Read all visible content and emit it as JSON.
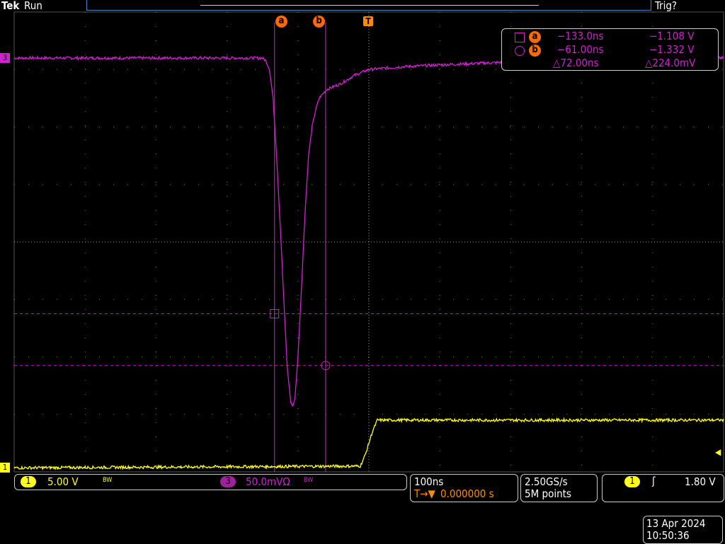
{
  "header": {
    "brand": "Tek",
    "status": "Run",
    "trigger_status": "Trig?"
  },
  "colors": {
    "ch1": "#ffff20",
    "ch3": "#d020d0",
    "cursor": "#ff6a00",
    "trigger": "#ff8c00",
    "grid": "#888888"
  },
  "markers": {
    "ch1": "1",
    "ch3": "3",
    "trigger": "T",
    "cursor_a": "a",
    "cursor_b": "b"
  },
  "cursor_readout": {
    "a": {
      "time": "−133.0ns",
      "volt": "−1.108 V"
    },
    "b": {
      "time": "−61.00ns",
      "volt": "−1.332 V"
    },
    "delta": {
      "time": "△72.00ns",
      "volt": "△224.0mV"
    }
  },
  "channels": {
    "ch1": {
      "label": "1",
      "scale": "5.00 V",
      "bw": "BW"
    },
    "ch3": {
      "label": "3",
      "scale": "50.0mVΩ",
      "bw": "BW"
    }
  },
  "horizontal": {
    "scale": "100ns",
    "delay_icon": "T→▼",
    "delay": "0.000000 s"
  },
  "acquisition": {
    "rate": "2.50GS/s",
    "record": "5M points"
  },
  "trigger": {
    "source": "1",
    "slope": "rising-edge",
    "level": "1.80 V"
  },
  "datetime": {
    "date": "13 Apr 2024",
    "time": "10:50:36"
  },
  "chart_data": {
    "type": "line",
    "x_unit": "ns",
    "x_per_div": 100,
    "x_range": [
      -500,
      500
    ],
    "y_unit": "div",
    "y_range": [
      -4,
      4
    ],
    "cursors": {
      "a": {
        "t": -133,
        "y_div": -1.25
      },
      "b": {
        "t": -61,
        "y_div": -2.15
      }
    },
    "series": [
      {
        "name": "CH3",
        "color": "#d020d0",
        "t": [
          -500,
          -150,
          -145,
          -140,
          -135,
          -130,
          -125,
          -120,
          -115,
          -110,
          -107,
          -104,
          -100,
          -95,
          -90,
          -85,
          -80,
          -75,
          -70,
          -60,
          -40,
          -20,
          0,
          50,
          100,
          200,
          500
        ],
        "y": [
          3.2,
          3.2,
          3.15,
          3.0,
          2.5,
          1.5,
          0.3,
          -1.0,
          -2.2,
          -2.8,
          -2.85,
          -2.7,
          -2.0,
          -0.8,
          0.5,
          1.5,
          2.0,
          2.3,
          2.5,
          2.65,
          2.75,
          2.9,
          3.0,
          3.05,
          3.08,
          3.13,
          3.2
        ]
      },
      {
        "name": "CH1",
        "color": "#ffff20",
        "t": [
          -500,
          -12,
          -5,
          0,
          5,
          12,
          500
        ],
        "y": [
          -3.93,
          -3.9,
          -3.7,
          -3.5,
          -3.3,
          -3.1,
          -3.1
        ]
      }
    ]
  }
}
